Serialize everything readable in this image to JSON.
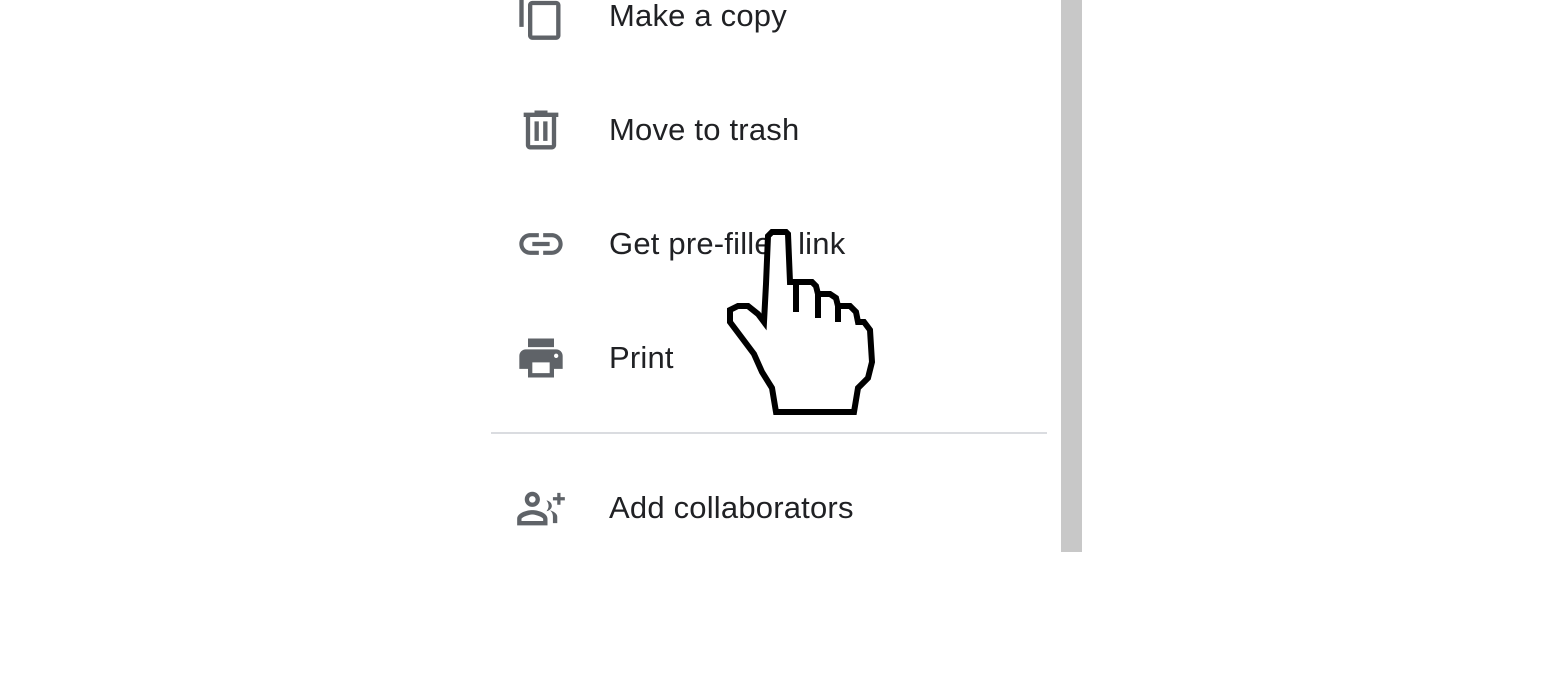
{
  "menu": {
    "items": [
      {
        "label": "Make a copy",
        "icon": "copy-icon"
      },
      {
        "label": "Move to trash",
        "icon": "trash-icon"
      },
      {
        "label": "Get pre-filled link",
        "icon": "link-icon"
      },
      {
        "label": "Print",
        "icon": "print-icon"
      },
      {
        "label": "Add collaborators",
        "icon": "add-people-icon"
      }
    ]
  },
  "colors": {
    "icon": "#5f6368",
    "text": "#202124",
    "divider": "#dadce0",
    "scrollbar": "#c8c8c8"
  },
  "cursor": {
    "icon": "hand-pointer-cursor"
  }
}
